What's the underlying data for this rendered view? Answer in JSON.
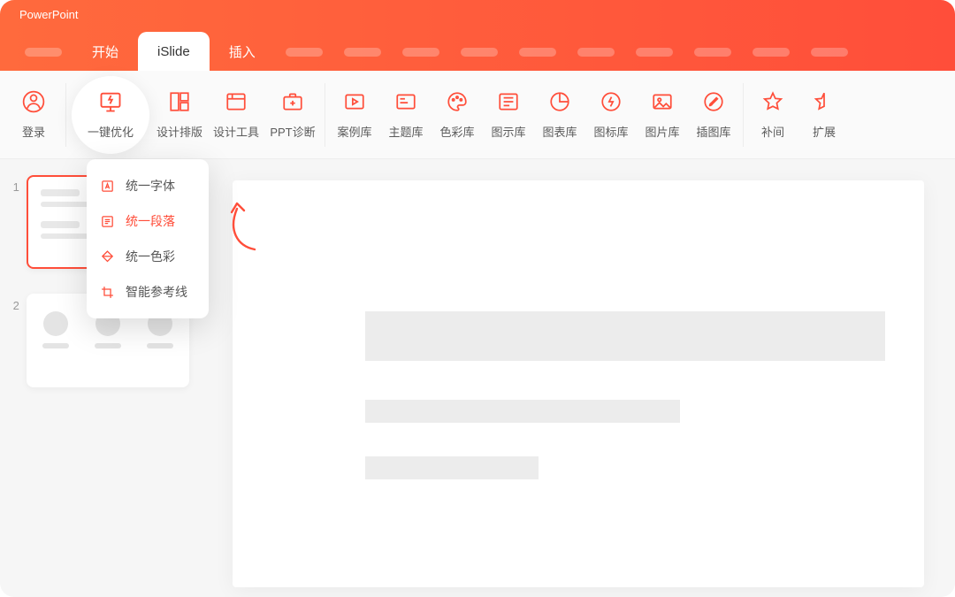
{
  "app": {
    "title": "PowerPoint"
  },
  "tabs": {
    "start": "开始",
    "islide": "iSlide",
    "insert": "插入",
    "active": "iSlide"
  },
  "ribbon": {
    "login": "登录",
    "optimize": "一键优化",
    "layout": "设计排版",
    "tools": "设计工具",
    "diagnose": "PPT诊断",
    "cases": "案例库",
    "themes": "主题库",
    "colors": "色彩库",
    "diagrams": "图示库",
    "charts": "图表库",
    "icons": "图标库",
    "images": "图片库",
    "vectors": "插图库",
    "tween": "补间",
    "extend": "扩展"
  },
  "dropdown": {
    "font": "统一字体",
    "paragraph": "统一段落",
    "color": "统一色彩",
    "guides": "智能参考线",
    "active": "paragraph"
  },
  "thumbs": {
    "n1": "1",
    "n2": "2"
  },
  "colors": {
    "accent": "#ff4e3a"
  }
}
